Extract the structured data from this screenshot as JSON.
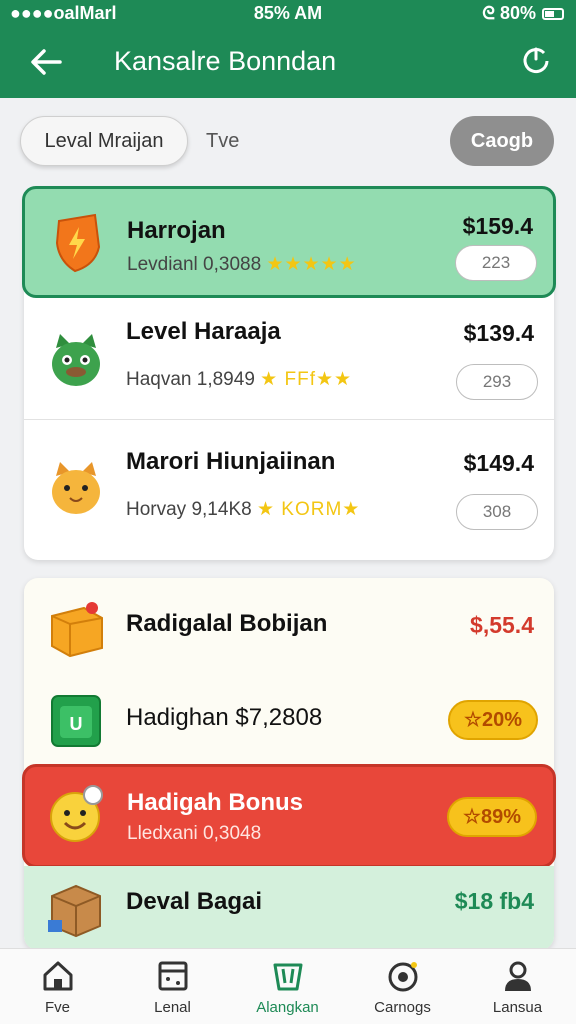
{
  "status": {
    "left": "●●●●oalMarl",
    "time": "85% AM",
    "right": "ᘓ 80%"
  },
  "appbar": {
    "title": "Kansalre Bonndan"
  },
  "filters": {
    "pill_label": "Leval Mraijan",
    "tab_label": "Tve",
    "cta_label": "Caogb"
  },
  "colors": {
    "brand": "#1e8a56",
    "highlight": "#93dcb0",
    "alert": "#e8473a",
    "gold": "#f7c21c"
  },
  "list_a": [
    {
      "icon": "shield-bolt-icon",
      "name": "Harrojan",
      "sub": "Levdianl 0,3088",
      "stars": "★★★★★",
      "price": "$159.4",
      "chip": "223"
    },
    {
      "icon": "green-cat-icon",
      "name": "Level Haraaja",
      "sub": "Haqvan 1,8949",
      "stars": "★ FFf★★",
      "price": "$139.4",
      "chip": "293"
    },
    {
      "icon": "orange-cat-icon",
      "name": "Marori Hiunjaiinan",
      "sub": "Horvay 9,14K8",
      "stars": "★ KORM★",
      "price": "$149.4",
      "chip": "308"
    }
  ],
  "list_b": [
    {
      "icon": "gift-box-icon",
      "name": "Radigalal Bobijan",
      "price": "$,55.4"
    },
    {
      "icon": "green-cash-icon",
      "name": "Hadighan $7,2808",
      "chip": "☆20%"
    },
    {
      "icon": "smiley-badge-icon",
      "name": "Hadigah Bonus",
      "sub": "Lledxani 0,3048",
      "chip": "☆89%"
    },
    {
      "icon": "cardboard-box-icon",
      "name": "Deval Bagai",
      "price": "$18 fb4"
    }
  ],
  "nav": [
    {
      "icon": "home-icon",
      "label": "Fve"
    },
    {
      "icon": "calendar-icon",
      "label": "Lenal"
    },
    {
      "icon": "bag-icon",
      "label": "Alangkan"
    },
    {
      "icon": "target-icon",
      "label": "Carnogs"
    },
    {
      "icon": "profile-icon",
      "label": "Lansua"
    }
  ]
}
